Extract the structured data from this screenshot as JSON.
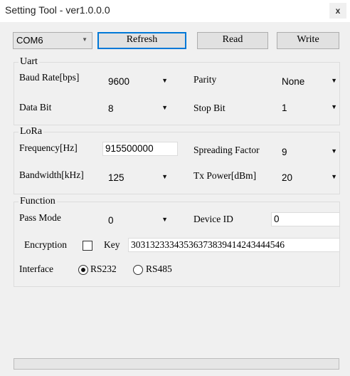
{
  "window": {
    "title": "Setting Tool - ver1.0.0.0",
    "close_glyph": "x"
  },
  "toolbar": {
    "port": "COM6",
    "refresh_label": "Refresh",
    "read_label": "Read",
    "write_label": "Write"
  },
  "uart": {
    "legend": "Uart",
    "baud_label": "Baud Rate[bps]",
    "baud_value": "9600",
    "parity_label": "Parity",
    "parity_value": "None",
    "databit_label": "Data Bit",
    "databit_value": "8",
    "stopbit_label": "Stop Bit",
    "stopbit_value": "1"
  },
  "lora": {
    "legend": "LoRa",
    "freq_label": "Frequency[Hz]",
    "freq_value": "915500000",
    "sf_label": "Spreading Factor",
    "sf_value": "9",
    "bw_label": "Bandwidth[kHz]",
    "bw_value": "125",
    "txp_label": "Tx Power[dBm]",
    "txp_value": "20"
  },
  "function": {
    "legend": "Function",
    "pass_label": "Pass Mode",
    "pass_value": "0",
    "devid_label": "Device ID",
    "devid_value": "0",
    "enc_label": "Encryption",
    "enc_checked": false,
    "key_label": "Key",
    "key_value": "30313233343536373839414243444546",
    "iface_label": "Interface",
    "rs232_label": "RS232",
    "rs485_label": "RS485",
    "iface_selected": "RS232"
  },
  "status": {
    "progress": 0
  },
  "icons": {
    "dropdown": "chevron-down-icon",
    "close": "close-icon"
  },
  "colors": {
    "window_bg": "#f0f0f0",
    "focus_border": "#0078d7"
  }
}
